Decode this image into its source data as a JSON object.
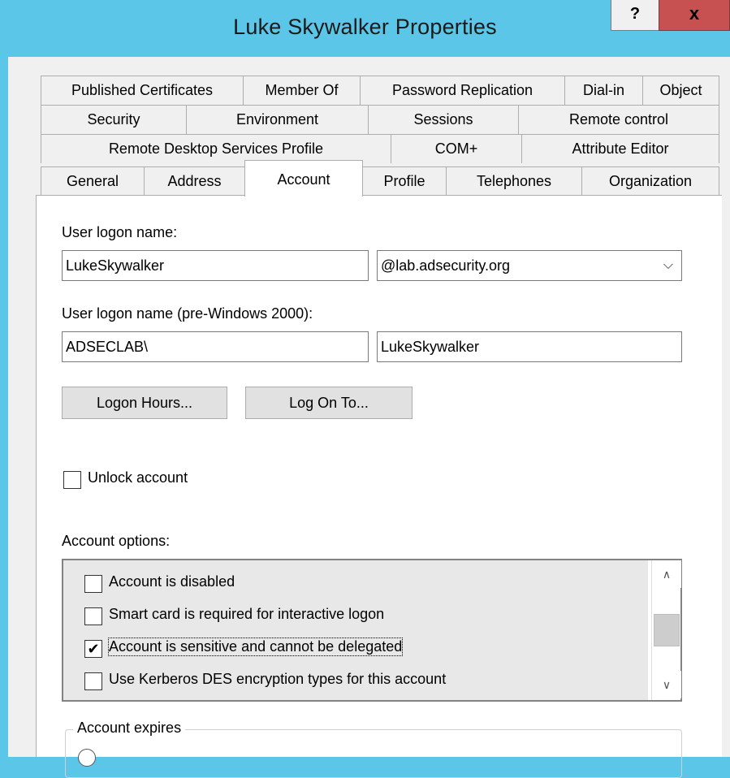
{
  "window": {
    "title": "Luke Skywalker Properties",
    "help_label": "?",
    "close_label": "x"
  },
  "tabs": {
    "row1": [
      "Published Certificates",
      "Member Of",
      "Password Replication",
      "Dial-in",
      "Object"
    ],
    "row2": [
      "Security",
      "Environment",
      "Sessions",
      "Remote control"
    ],
    "row3": [
      "Remote Desktop Services Profile",
      "COM+",
      "Attribute Editor"
    ],
    "row4": [
      "General",
      "Address",
      "Account",
      "Profile",
      "Telephones",
      "Organization"
    ],
    "selected": "Account"
  },
  "account": {
    "logon_name_label": "User logon name:",
    "logon_name_value": "LukeSkywalker",
    "domain_value": "@lab.adsecurity.org",
    "pre2000_label": "User logon name (pre-Windows 2000):",
    "pre2000_domain": "ADSECLAB\\",
    "pre2000_user": "LukeSkywalker",
    "logon_hours_button": "Logon Hours...",
    "log_on_to_button": "Log On To...",
    "unlock_label": "Unlock account",
    "options_label": "Account options:",
    "options": [
      {
        "label": "Account is disabled",
        "checked": false
      },
      {
        "label": "Smart card is required for interactive logon",
        "checked": false
      },
      {
        "label": "Account is sensitive and cannot be delegated",
        "checked": true
      },
      {
        "label": "Use Kerberos DES encryption types for this account",
        "checked": false
      }
    ],
    "expires_label": "Account expires"
  }
}
